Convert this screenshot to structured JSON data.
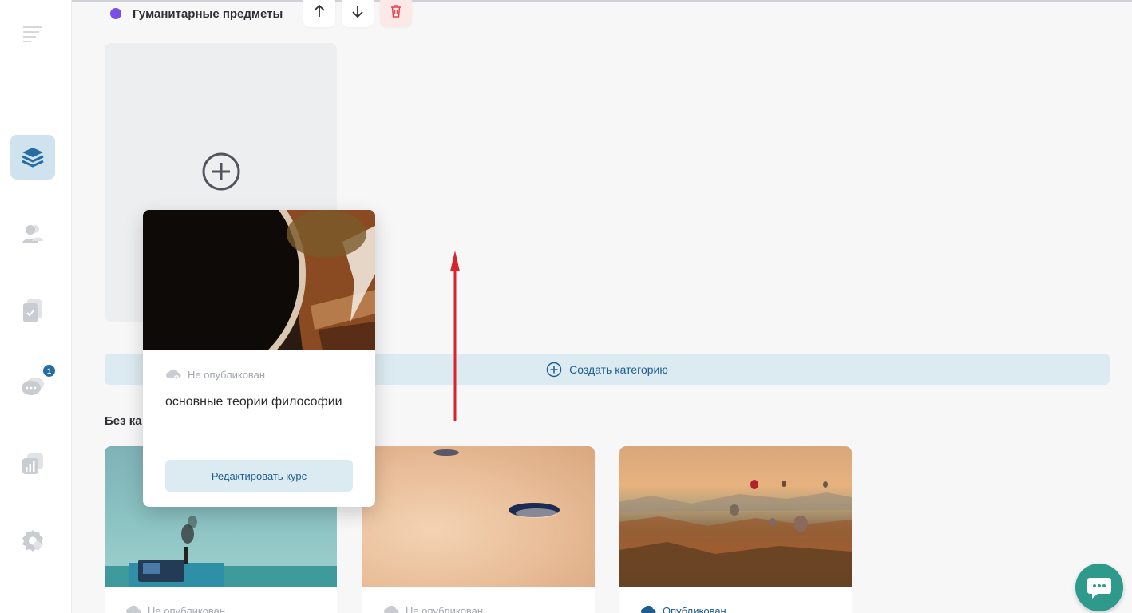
{
  "category": {
    "title": "Гуманитарные предметы",
    "dot_color": "#7a4fe6"
  },
  "create_course": {
    "label": "Создать курс"
  },
  "create_category": {
    "label": "Создать категорию"
  },
  "uncategorized": {
    "title": "Без ка"
  },
  "dragged_course": {
    "status": "Не опубликован",
    "title": "основные теории философии",
    "edit_label": "Редактировать курс"
  },
  "courses": [
    {
      "status": "Не опубликован",
      "image": "tractor"
    },
    {
      "status": "Не опубликован",
      "image": "sand"
    },
    {
      "status": "Опубликован",
      "image": "balloons"
    }
  ],
  "sidebar": {
    "messages_badge": "1",
    "icons": [
      "menu-icon",
      "courses-stack-icon",
      "users-icon",
      "assignments-icon",
      "messages-icon",
      "analytics-icon",
      "settings-icon"
    ]
  },
  "colors": {
    "accent": "#1f5d8e",
    "active_sidebar": "#cfe3ef",
    "chat_fab": "#2e9a8c",
    "annotation_arrow": "#d8232a"
  }
}
